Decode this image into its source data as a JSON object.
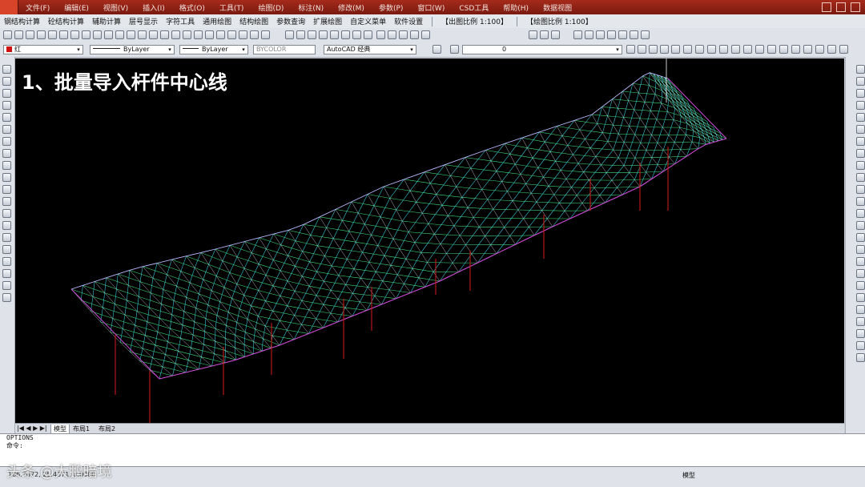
{
  "menu": [
    "文件(F)",
    "编辑(E)",
    "视图(V)",
    "插入(I)",
    "格式(O)",
    "工具(T)",
    "绘图(D)",
    "标注(N)",
    "修改(M)",
    "参数(P)",
    "窗口(W)",
    "CSD工具",
    "帮助(H)",
    "数据视图"
  ],
  "toolbar1": [
    "钢结构计算",
    "砼结构计算",
    "辅助计算",
    "层号显示",
    "字符工具",
    "通用绘图",
    "结构绘图",
    "参数查询",
    "扩展绘图",
    "自定义菜单",
    "软件设置"
  ],
  "scale_left": "【出图比例 1:100】",
  "scale_right": "【绘图比例 1:100】",
  "props": {
    "color": "红",
    "linetype": "ByLayer",
    "lineweight": "ByLayer",
    "plotstyle": "BYCOLOR",
    "workspace": "AutoCAD 经典",
    "layer": "0"
  },
  "title": "1、批量导入杆件中心线",
  "tabs": [
    "模型",
    "布局1",
    "布局2"
  ],
  "command": [
    "OPTIONS",
    "命令:"
  ],
  "status": {
    "coords": "186.7672, 25.4371, 0.0000",
    "model_label": "模型",
    "watermark": "头条 @大鹏暗境"
  },
  "colors": {
    "grid_green": "#3fe07a",
    "grid_cyan": "#3ad8e8",
    "grid_white": "#e8e8ff",
    "edge_magenta": "#d04bd8",
    "column_red": "#c81818"
  }
}
